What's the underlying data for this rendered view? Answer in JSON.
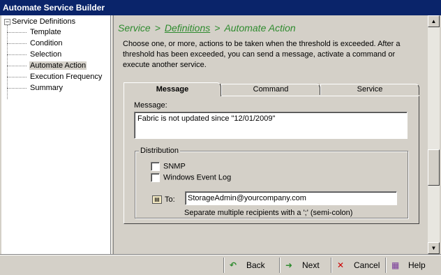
{
  "window": {
    "title": "Automate Service Builder"
  },
  "tree": {
    "root_expander": "−",
    "root_label": "Service Definitions",
    "items": [
      {
        "label": "Template"
      },
      {
        "label": "Condition"
      },
      {
        "label": "Selection"
      },
      {
        "label": "Automate Action"
      },
      {
        "label": "Execution Frequency"
      },
      {
        "label": "Summary"
      }
    ],
    "selected": "Automate Action"
  },
  "breadcrumb": {
    "part1": "Service",
    "sep": ">",
    "part2": "Definitions",
    "part3": "Automate Action"
  },
  "description": "Choose one, or more, actions to be taken when the threshold is exceeded. After a threshold has been exceeded, you can send a message, activate a command or execute another service.",
  "tabs": [
    {
      "label": "Message"
    },
    {
      "label": "Command"
    },
    {
      "label": "Service"
    }
  ],
  "active_tab": "Message",
  "message": {
    "label": "Message:",
    "value": "Fabric  is not updated since \"12/01/2009\""
  },
  "distribution": {
    "legend": "Distribution",
    "snmp_label": "SNMP",
    "snmp_checked": false,
    "event_log_label": "Windows Event Log",
    "event_log_checked": false,
    "to_label": "To:",
    "to_value": "StorageAdmin@yourcompany.com",
    "hint": "Separate multiple recipients with a ';' (semi-colon)"
  },
  "buttons": {
    "back": "Back",
    "next": "Next",
    "cancel": "Cancel",
    "help": "Help"
  },
  "colors": {
    "title_bar": "#0a246a",
    "breadcrumb": "#2e8b2e",
    "cancel_icon": "#cc0000",
    "arrow_icon": "#2e8b2e"
  },
  "icons": {
    "back": "back-arrow-icon",
    "next": "next-arrow-icon",
    "cancel": "cancel-x-icon",
    "help": "help-book-icon",
    "address_book": "address-book-icon"
  }
}
